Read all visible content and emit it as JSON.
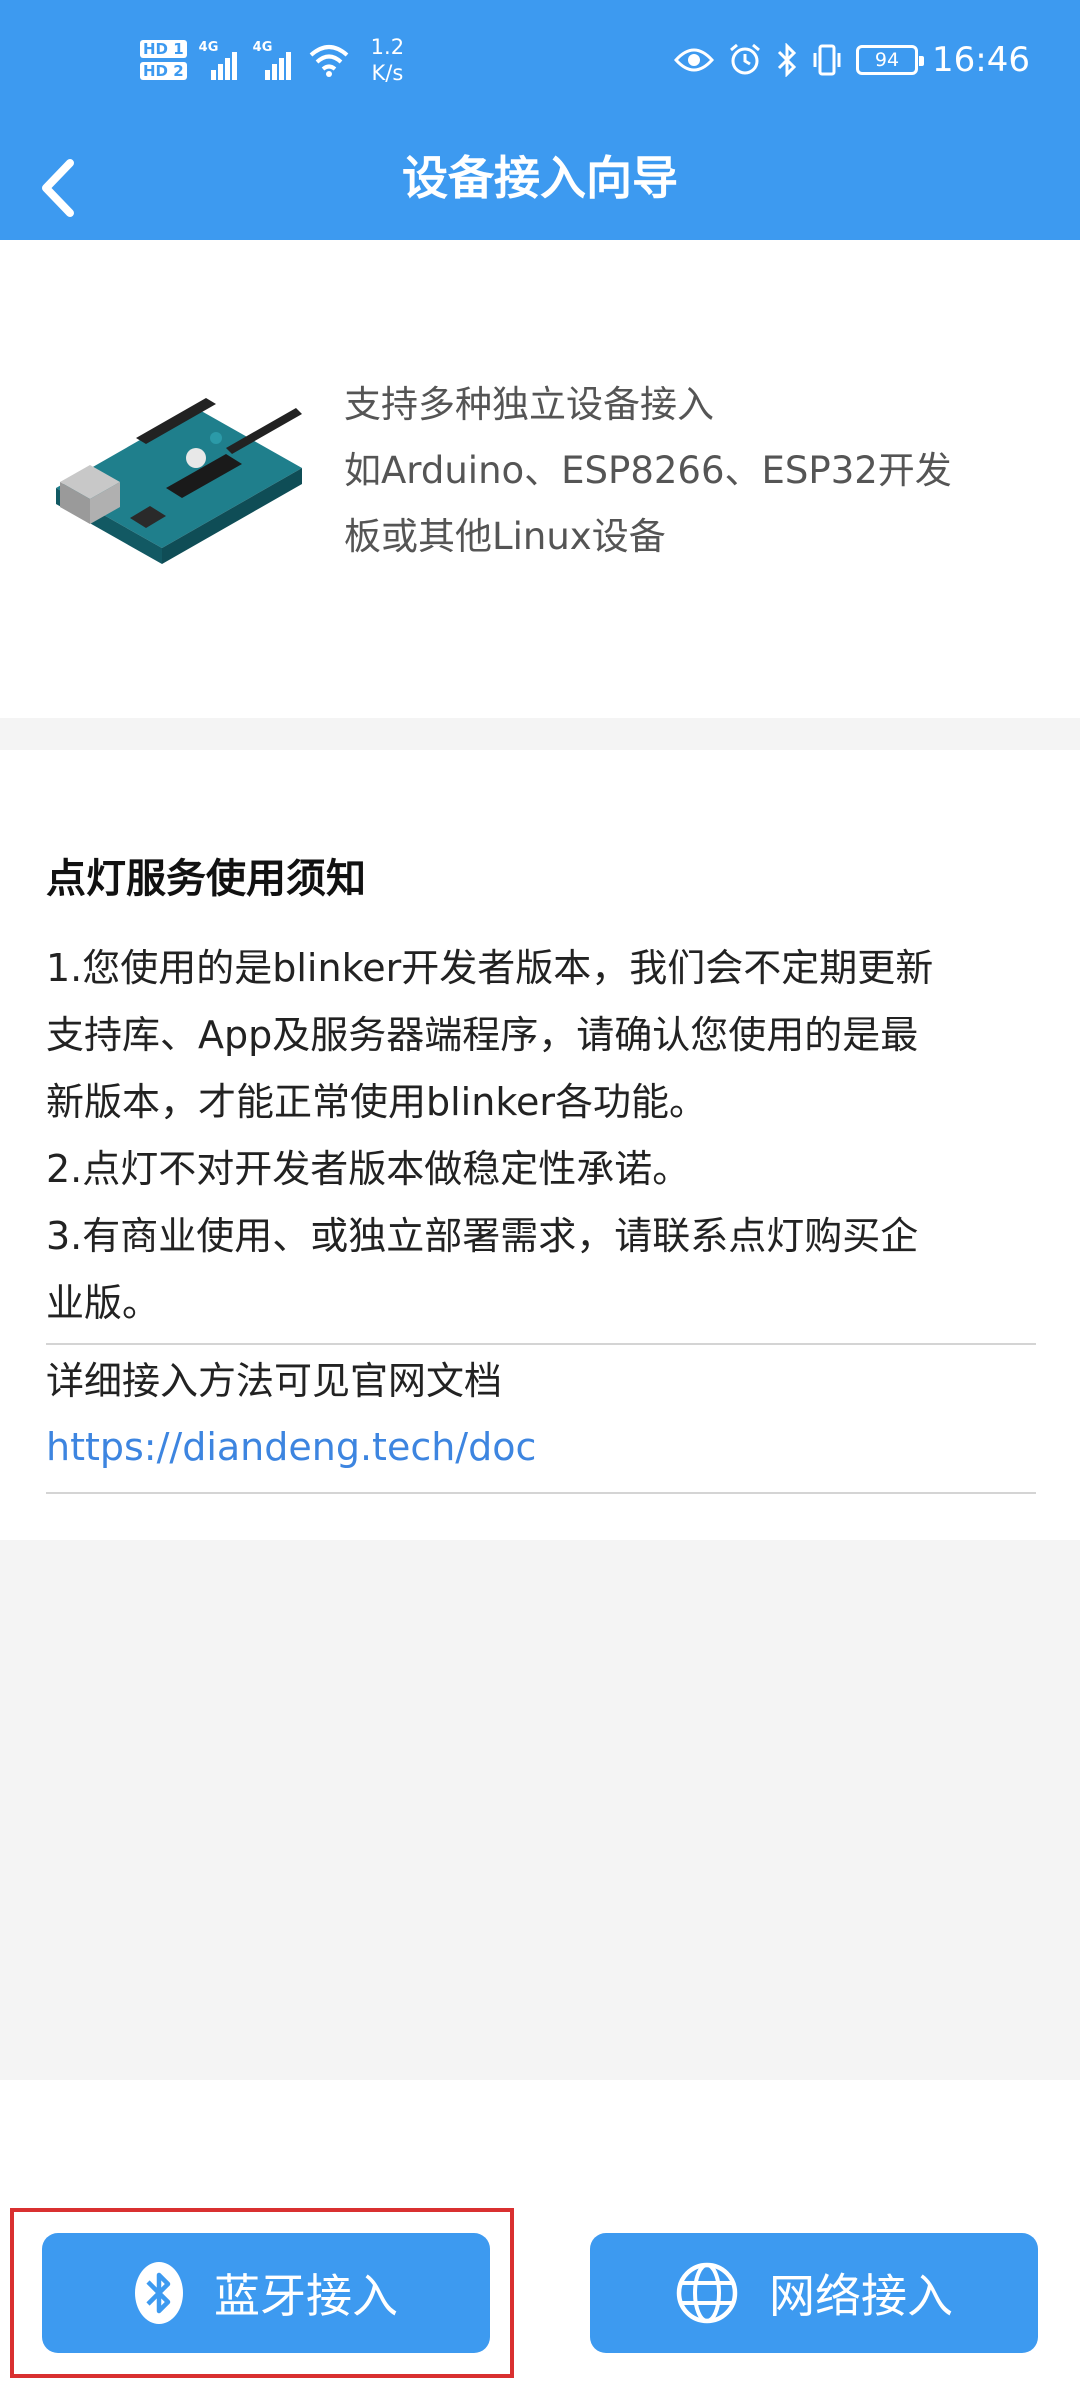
{
  "status_bar": {
    "sim1": "HD 1",
    "sim2": "HD 2",
    "net1": "4G",
    "net2": "4G",
    "speed_value": "1.2",
    "speed_unit": "K/s",
    "battery": "94",
    "time": "16:46",
    "icons": [
      "eye-icon",
      "alarm-icon",
      "bluetooth-icon",
      "vibrate-icon"
    ]
  },
  "nav": {
    "title": "设备接入向导",
    "back_icon": "chevron-left-icon"
  },
  "intro": {
    "image": "arduino-board-image",
    "text_line1": "支持多种独立设备接入",
    "text_line2": "如Arduino、ESP8266、ESP32开发",
    "text_line3": "板或其他Linux设备"
  },
  "notice": {
    "title": "点灯服务使用须知",
    "line1": "1.您使用的是blinker开发者版本，我们会不定期更新",
    "line2": "支持库、App及服务器端程序，请确认您使用的是最",
    "line3": "新版本，才能正常使用blinker各功能。",
    "line4": "2.点灯不对开发者版本做稳定性承诺。",
    "line5": "3.有商业使用、或独立部署需求，请联系点灯购买企",
    "line6": "业版。",
    "doc_hint": "详细接入方法可见官网文档",
    "doc_link": "https://diandeng.tech/doc"
  },
  "buttons": {
    "bluetooth_label": "蓝牙接入",
    "network_label": "网络接入"
  },
  "colors": {
    "primary": "#3d9af0",
    "link": "#3d85e0",
    "highlight": "#d93030"
  }
}
